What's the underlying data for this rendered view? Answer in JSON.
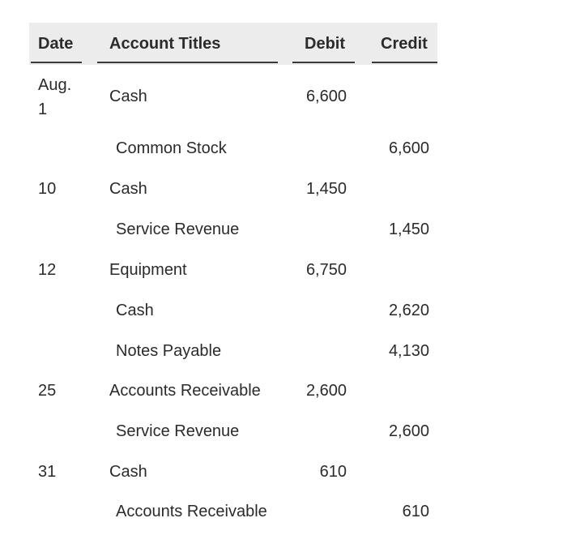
{
  "table": {
    "headers": {
      "date": "Date",
      "account_titles": "Account Titles",
      "debit": "Debit",
      "credit": "Credit"
    },
    "rows": [
      {
        "date_line1": "Aug.",
        "date_line2": "1",
        "account": "Cash",
        "debit": "6,600",
        "credit": "",
        "indented": false
      },
      {
        "date": "",
        "account": "Common Stock",
        "debit": "",
        "credit": "6,600",
        "indented": true
      },
      {
        "date": "10",
        "account": "Cash",
        "debit": "1,450",
        "credit": "",
        "indented": false
      },
      {
        "date": "",
        "account": "Service Revenue",
        "debit": "",
        "credit": "1,450",
        "indented": true
      },
      {
        "date": "12",
        "account": "Equipment",
        "debit": "6,750",
        "credit": "",
        "indented": false
      },
      {
        "date": "",
        "account": "Cash",
        "debit": "",
        "credit": "2,620",
        "indented": true
      },
      {
        "date": "",
        "account": "Notes Payable",
        "debit": "",
        "credit": "4,130",
        "indented": true
      },
      {
        "date": "25",
        "account": "Accounts Receivable",
        "debit": "2,600",
        "credit": "",
        "indented": false
      },
      {
        "date": "",
        "account": "Service Revenue",
        "debit": "",
        "credit": "2,600",
        "indented": true
      },
      {
        "date": "31",
        "account": "Cash",
        "debit": "610",
        "credit": "",
        "indented": false
      },
      {
        "date": "",
        "account": "Accounts Receivable",
        "debit": "",
        "credit": "610",
        "indented": true
      }
    ]
  }
}
